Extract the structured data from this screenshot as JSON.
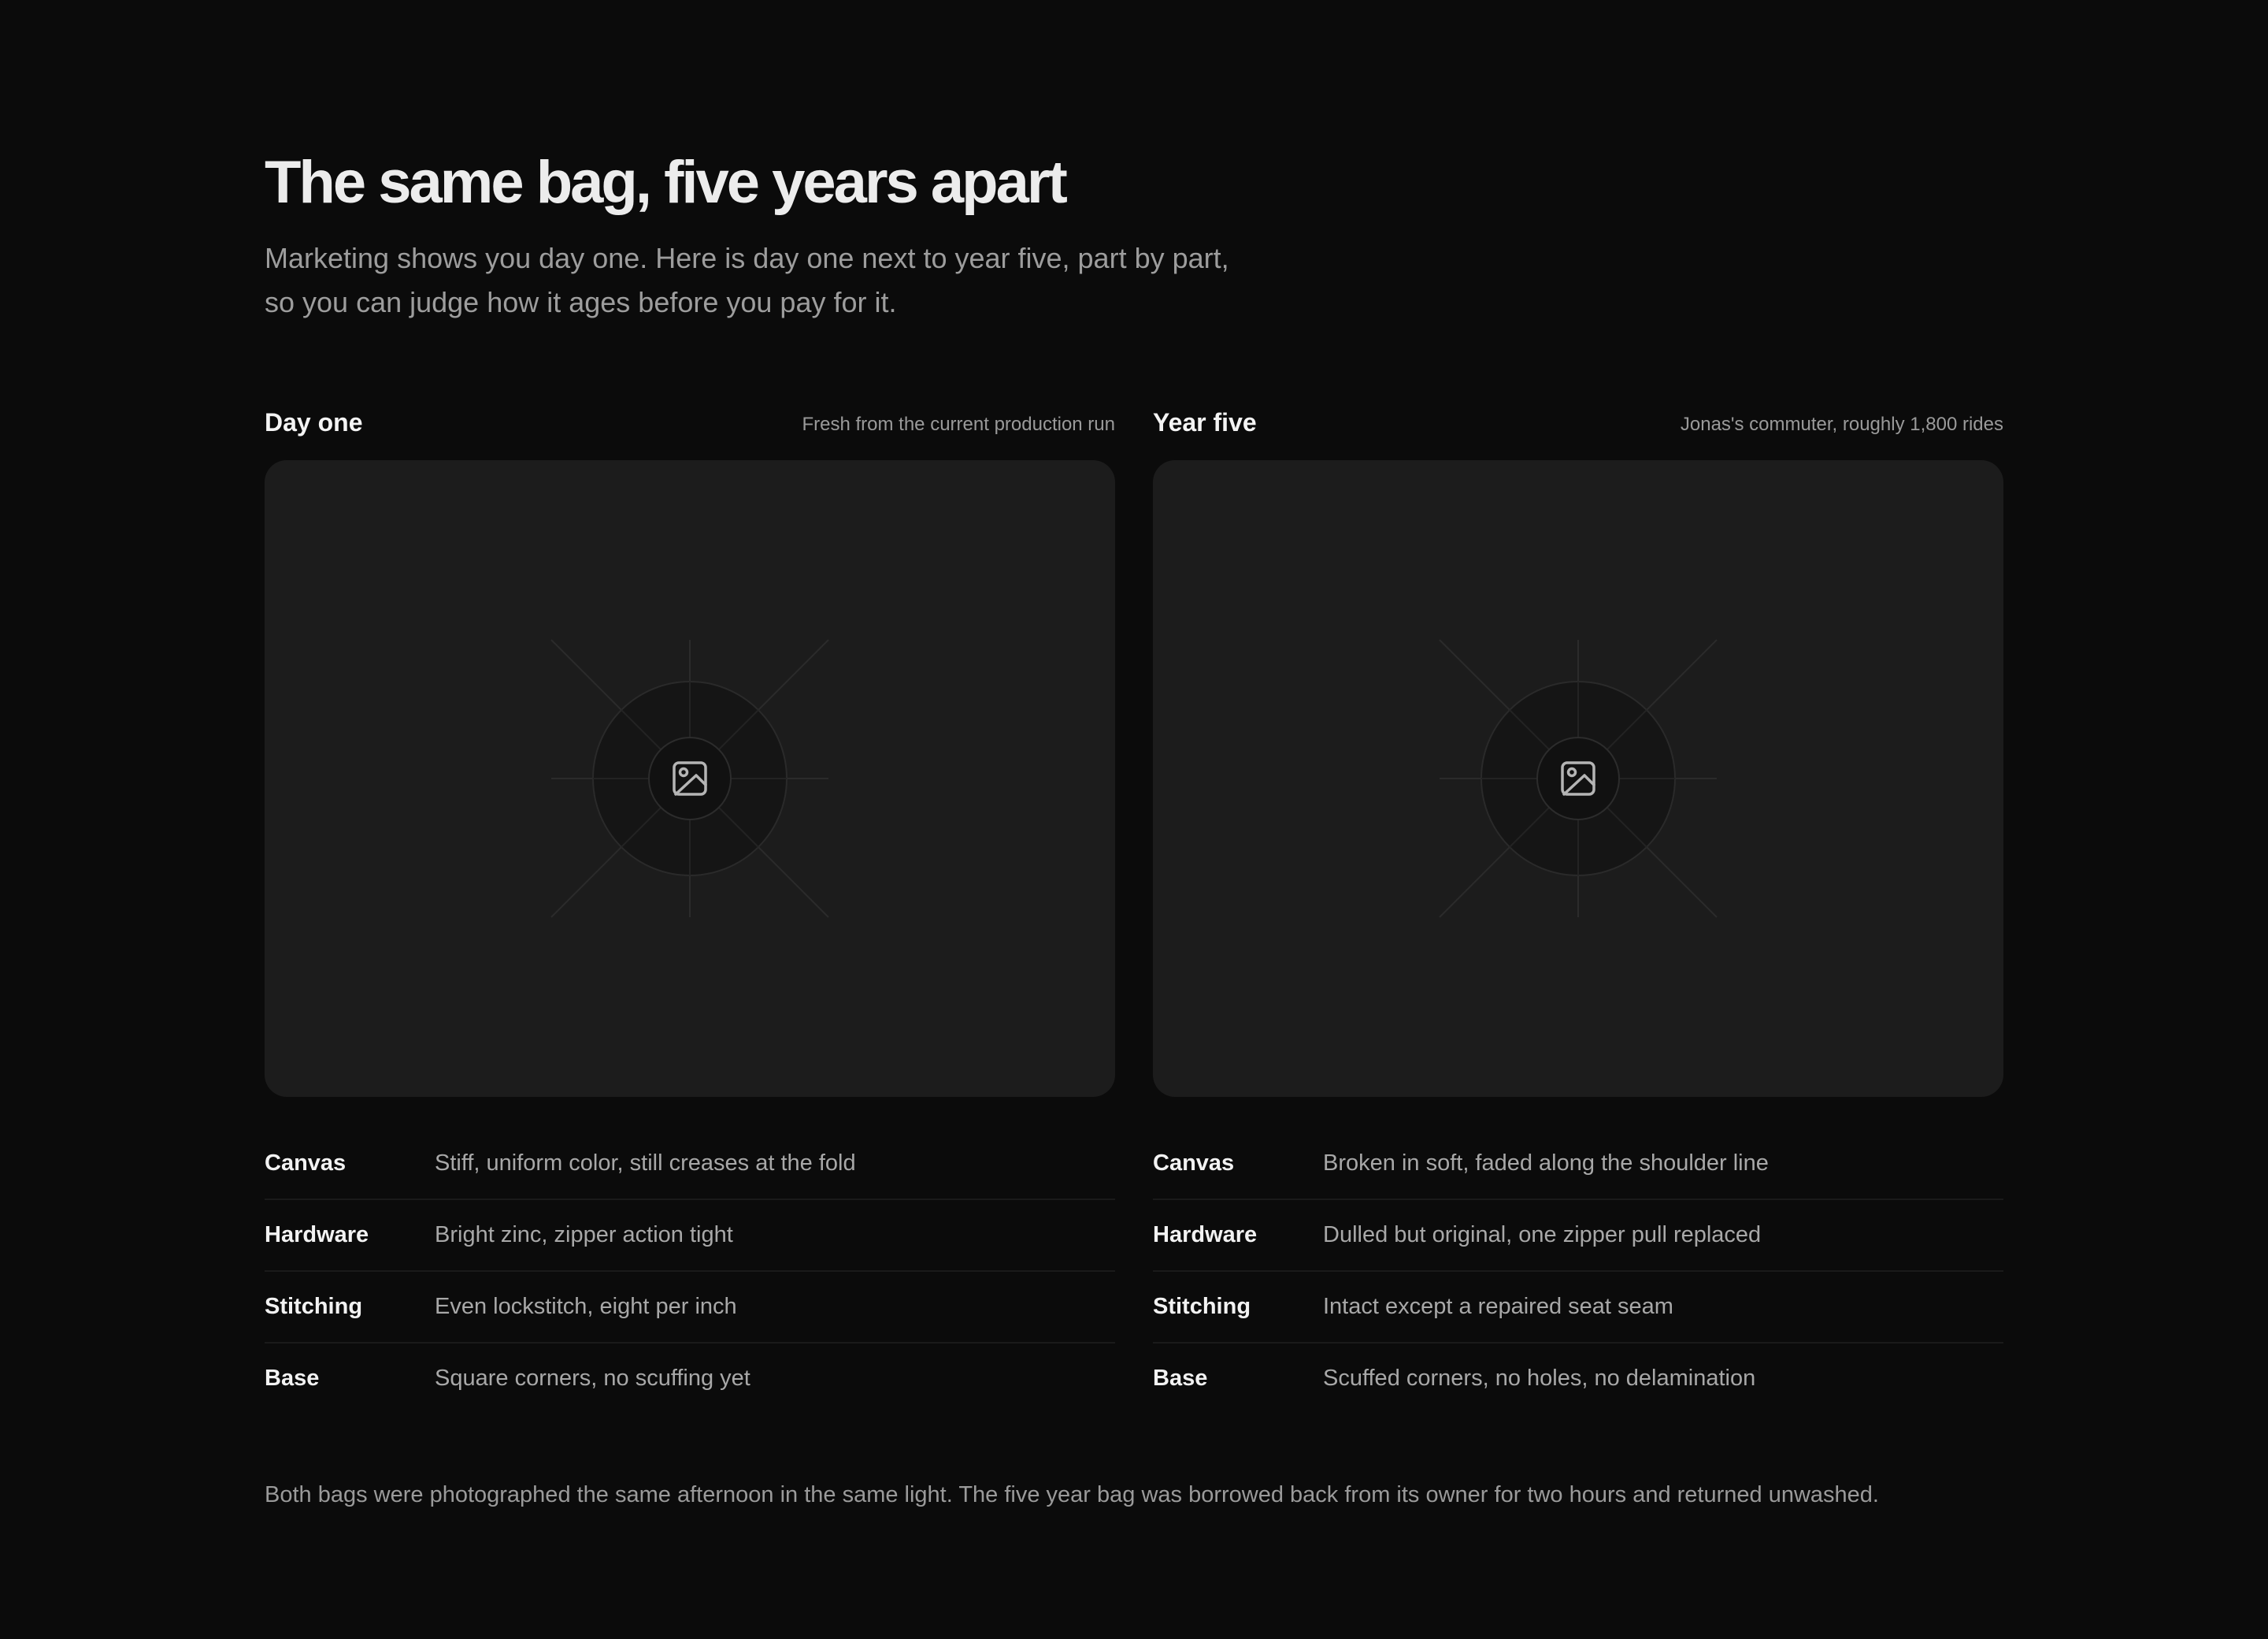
{
  "header": {
    "title": "The same bag, five years apart",
    "intro_line_1": "Marketing shows you day one. Here is day one next to year five, part by part,",
    "intro_line_2": "so you can judge how it ages before you pay for it."
  },
  "columns": [
    {
      "title": "Day one",
      "caption": "Fresh from the current production run",
      "image_icon": "image-icon",
      "specs": [
        {
          "label": "Canvas",
          "value": "Stiff, uniform color, still creases at the fold"
        },
        {
          "label": "Hardware",
          "value": "Bright zinc, zipper action tight"
        },
        {
          "label": "Stitching",
          "value": "Even lockstitch, eight per inch"
        },
        {
          "label": "Base",
          "value": "Square corners, no scuffing yet"
        }
      ]
    },
    {
      "title": "Year five",
      "caption": "Jonas's commuter, roughly 1,800 rides",
      "image_icon": "image-icon",
      "specs": [
        {
          "label": "Canvas",
          "value": "Broken in soft, faded along the shoulder line"
        },
        {
          "label": "Hardware",
          "value": "Dulled but original, one zipper pull replaced"
        },
        {
          "label": "Stitching",
          "value": "Intact except a repaired seat seam"
        },
        {
          "label": "Base",
          "value": "Scuffed corners, no holes, no delamination"
        }
      ]
    }
  ],
  "footnote": "Both bags were photographed the same afternoon in the same light. The five year bag was borrowed back from its owner for two hours and returned unwashed.",
  "colors": {
    "background": "#0b0b0b",
    "panel": "#1c1c1c",
    "heading": "#ececec",
    "muted_text": "#9d9d9d"
  }
}
